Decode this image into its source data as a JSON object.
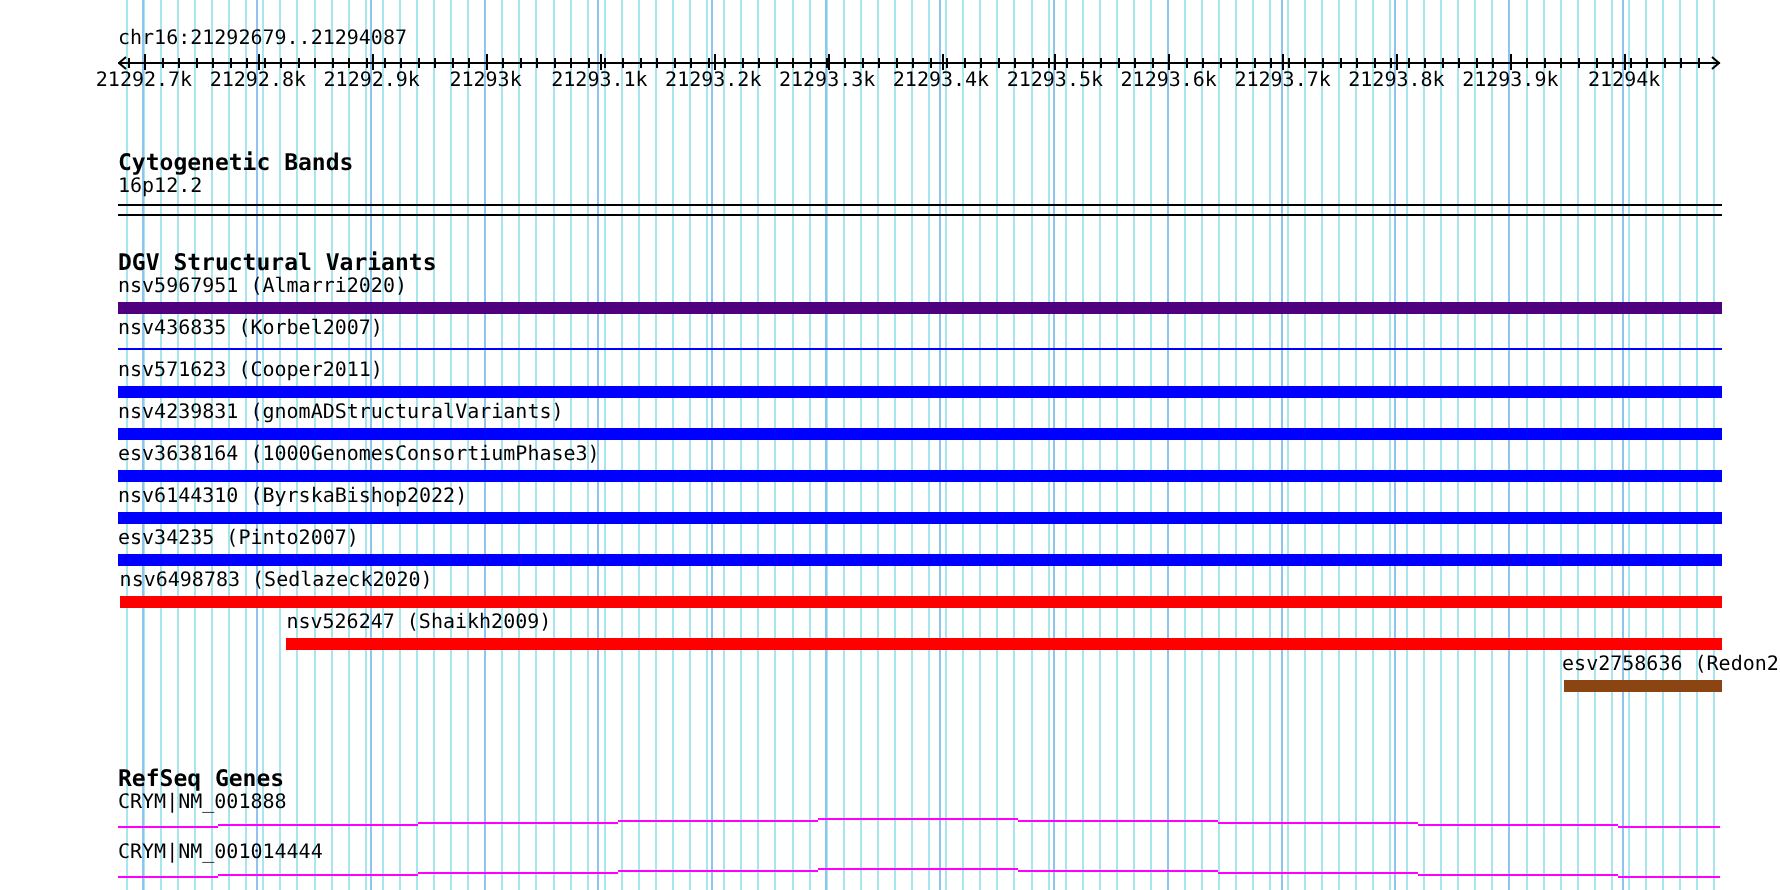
{
  "ruler": {
    "position": "chr16:21292679..21294087",
    "ticks": [
      "21292.7k",
      "21292.8k",
      "21292.9k",
      "21293k",
      "21293.1k",
      "21293.2k",
      "21293.3k",
      "21293.4k",
      "21293.5k",
      "21293.6k",
      "21293.7k",
      "21293.8k",
      "21293.9k",
      "21294k"
    ]
  },
  "cytogenetic_bands": {
    "title": "Cytogenetic Bands",
    "band": "16p12.2"
  },
  "dgv_structural_variants": {
    "title": "DGV Structural Variants",
    "items": [
      {
        "label": "nsv5967951 (Almarri2020)",
        "kind": "thick",
        "color": "#4f007f",
        "level": 1
      },
      {
        "label": "nsv436835 (Korbel2007)",
        "kind": "thin",
        "color": "#0000ff",
        "level": 1
      },
      {
        "label": "nsv571623 (Cooper2011)",
        "kind": "thick",
        "color": "#0000ff",
        "level": 1
      },
      {
        "label": "nsv4239831 (gnomADStructuralVariants)",
        "kind": "thick",
        "color": "#0000ff",
        "level": 1
      },
      {
        "label": "esv3638164 (1000GenomesConsortiumPhase3)",
        "kind": "thick",
        "color": "#0000ff",
        "level": 1
      },
      {
        "label": "nsv6144310 (ByrskaBishop2022)",
        "kind": "thick",
        "color": "#0000ff",
        "level": 1
      },
      {
        "label": "esv34235 (Pinto2007)",
        "kind": "thick",
        "color": "#0000ff",
        "level": 1
      },
      {
        "label": "nsv6498783 (Sedlazeck2020)",
        "kind": "thick",
        "color": "#ff0000",
        "level": 0.999
      },
      {
        "label": "nsv526247 (Shaikh2009)",
        "kind": "thick",
        "color": "#ff0000",
        "level": 0.895
      },
      {
        "label": "esv2758636 (Redon2",
        "kind": "thick",
        "color": "#8b4513",
        "level": 0.099
      }
    ]
  },
  "refseq_genes": {
    "title": "RefSeq Genes",
    "genes": [
      {
        "label": "CRYM|NM_001888"
      },
      {
        "label": "CRYM|NM_001014444"
      }
    ]
  }
}
